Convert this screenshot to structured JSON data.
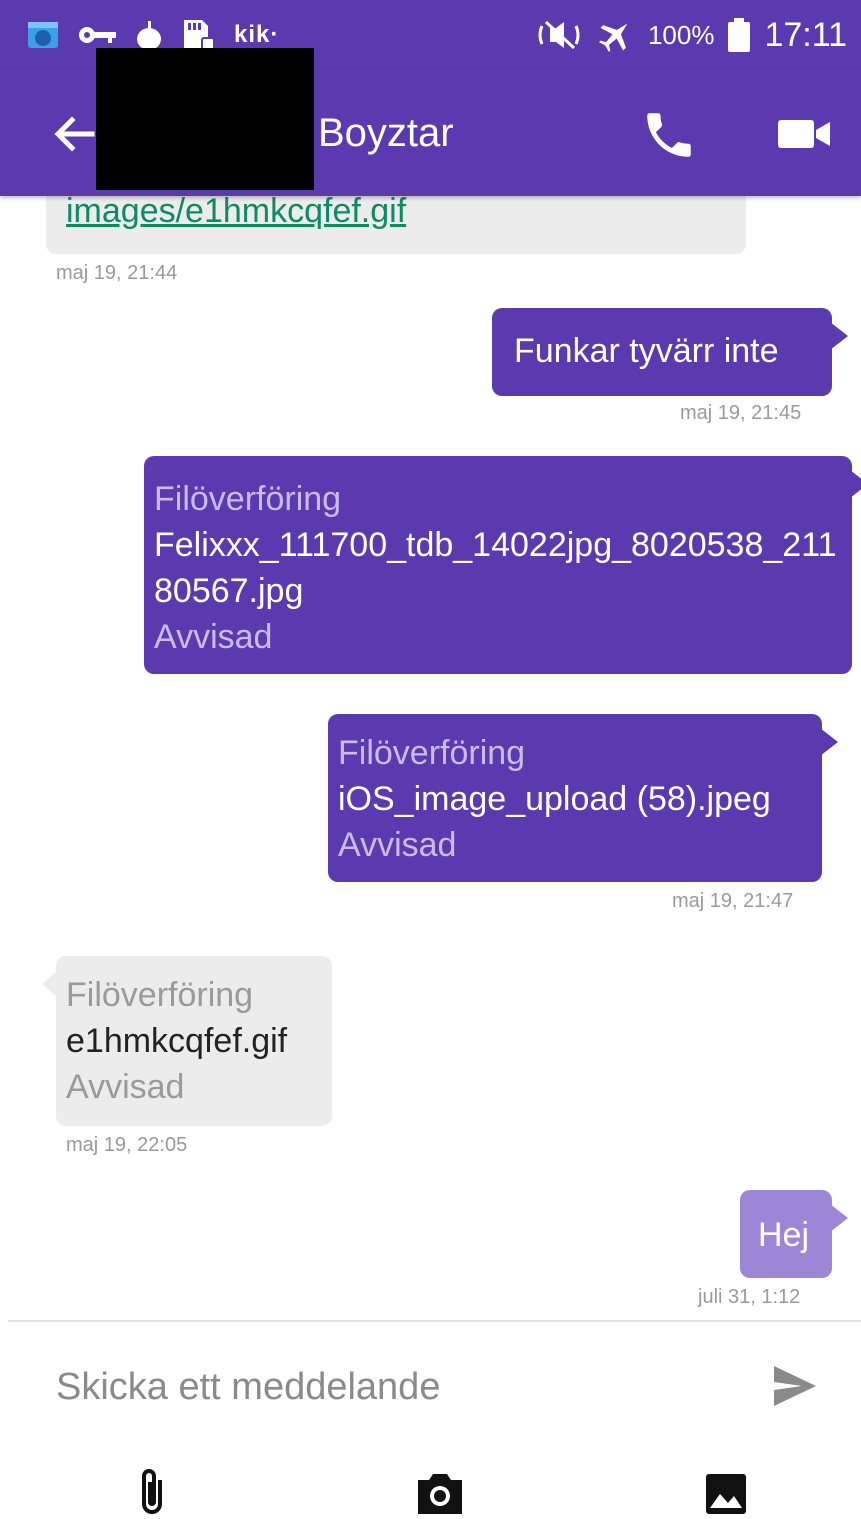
{
  "status_bar": {
    "kik_label": "kik·",
    "battery_percent": "100%",
    "time": "17:11",
    "icons": [
      "gallery-notification-icon",
      "key-icon",
      "apple-icon",
      "sd-card-icon",
      "mute-icon",
      "airplane-mode-icon",
      "battery-icon"
    ]
  },
  "toolbar": {
    "contact_name": "Boyztar",
    "icons": [
      "back-arrow-icon",
      "phone-call-icon",
      "video-call-icon"
    ]
  },
  "messages": [
    {
      "direction": "incoming",
      "type": "link",
      "text": "images/e1hmkcqfef.gif",
      "timestamp": "maj 19, 21:44"
    },
    {
      "direction": "outgoing",
      "type": "text",
      "text": "Funkar tyvärr inte",
      "timestamp": "maj 19, 21:45"
    },
    {
      "direction": "outgoing",
      "type": "file",
      "label": "Filöverföring",
      "filename": "Felixxx_111700_tdb_14022jpg_8020538_21180567.jpg",
      "status": "Avvisad"
    },
    {
      "direction": "outgoing",
      "type": "file",
      "label": "Filöverföring",
      "filename": "iOS_image_upload (58).jpeg",
      "status": "Avvisad",
      "timestamp": "maj 19, 21:47"
    },
    {
      "direction": "incoming",
      "type": "file",
      "label": "Filöverföring",
      "filename": "e1hmkcqfef.gif",
      "status": "Avvisad",
      "timestamp": "maj 19, 22:05"
    },
    {
      "direction": "outgoing",
      "type": "text",
      "text": "Hej",
      "timestamp": "juli 31,  1:12"
    }
  ],
  "composer": {
    "placeholder": "Skicka ett meddelande",
    "send_icon": "send-icon",
    "action_icons": [
      "attachment-icon",
      "camera-icon",
      "image-icon"
    ]
  },
  "colors": {
    "primary": "#5b3ab0",
    "outgoing_light": "#9c86d5",
    "incoming_bubble": "#ececec",
    "link": "#0f8a63"
  }
}
